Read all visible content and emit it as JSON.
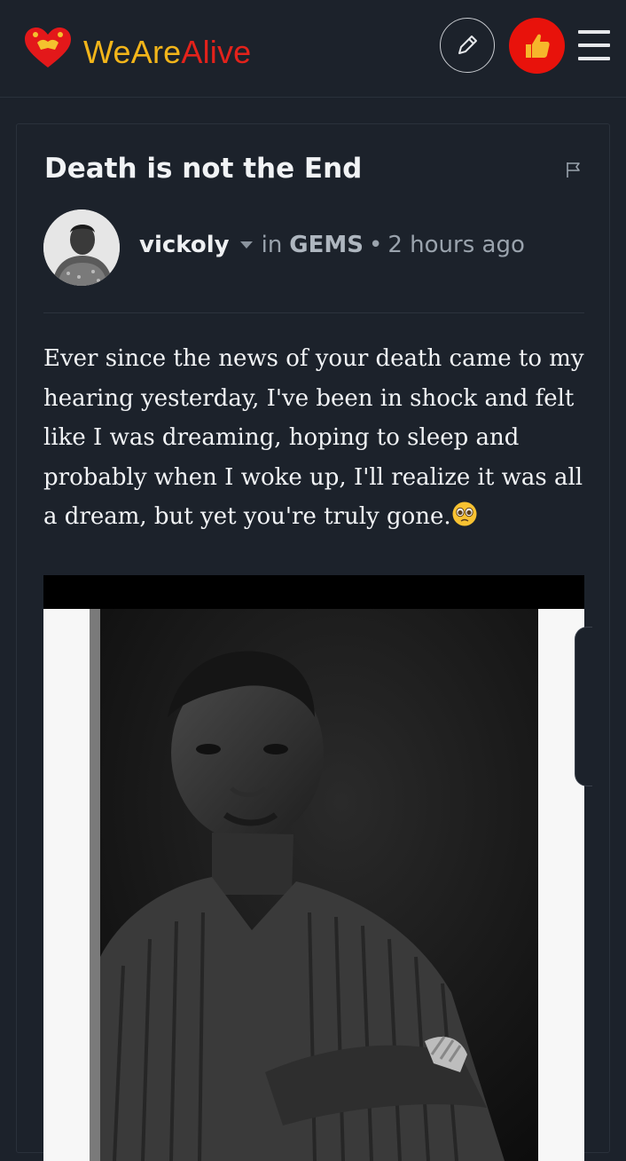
{
  "header": {
    "brand_we": "We",
    "brand_are": "Are",
    "brand_alive": "Alive",
    "edit_icon": "pencil-icon",
    "vote_icon": "thumbs-up-icon",
    "menu_icon": "hamburger-menu-icon"
  },
  "post": {
    "title": "Death is not the End",
    "author": "vickoly",
    "in_label": "in",
    "community": "GEMS",
    "time": "2 hours ago",
    "body": "Ever since the news of your death came to my hearing yesterday, I've been in shock and felt like I was dreaming, hoping to sleep and probably when I woke up, I'll realize it was all a dream, but yet you're truly gone.",
    "body_emoji": "pleading-face-emoji"
  },
  "colors": {
    "background": "#1c222b",
    "accent_red": "#e8120b",
    "brand_yellow": "#f2b51a",
    "brand_red": "#e3221b"
  }
}
